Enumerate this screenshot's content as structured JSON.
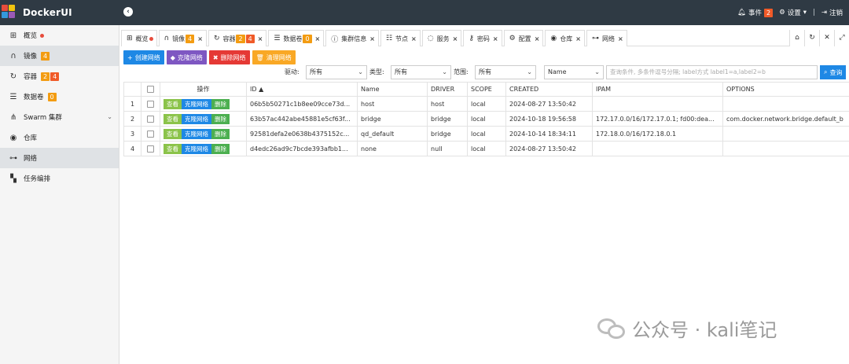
{
  "app": {
    "title": "DockerUI"
  },
  "topbar": {
    "events_label": "事件",
    "events_count": "2",
    "settings_label": "设置",
    "separator": "|",
    "logout_label": "注销"
  },
  "sidebar": {
    "items": [
      {
        "label": "概览",
        "icon": "windows-icon"
      },
      {
        "label": "镜像",
        "badge1": "4",
        "icon": "headphones-icon"
      },
      {
        "label": "容器",
        "badge1": "2",
        "badge2": "4",
        "icon": "refresh-icon"
      },
      {
        "label": "数据卷",
        "badge1": "0",
        "icon": "database-icon"
      },
      {
        "label": "Swarm 集群",
        "icon": "sitemap-icon"
      },
      {
        "label": "仓库",
        "icon": "podcast-icon"
      },
      {
        "label": "网络",
        "icon": "usb-icon"
      },
      {
        "label": "任务编排",
        "icon": "cubes-icon"
      }
    ]
  },
  "tabs": [
    {
      "label": "概览"
    },
    {
      "label": "镜像",
      "badge": "4"
    },
    {
      "label": "容器",
      "badge1": "2",
      "badge2": "4"
    },
    {
      "label": "数据卷",
      "badge": "0"
    },
    {
      "label": "集群信息"
    },
    {
      "label": "节点"
    },
    {
      "label": "服务"
    },
    {
      "label": "密码"
    },
    {
      "label": "配置"
    },
    {
      "label": "仓库"
    },
    {
      "label": "网络"
    }
  ],
  "toolbar": {
    "create": "创建网络",
    "clone": "克隆网络",
    "delete": "删除网络",
    "prune": "清理网络"
  },
  "filters": {
    "driver_label": "驱动:",
    "driver_value": "所有",
    "type_label": "类型:",
    "type_value": "所有",
    "scope_label": "范围:",
    "scope_value": "所有",
    "field_value": "Name",
    "search_placeholder": "查询条件, 多条件逗号分隔; label方式 label1=a,label2=b",
    "search_button": "查询"
  },
  "table": {
    "headers": {
      "ops": "操作",
      "id": "ID ▲",
      "name": "Name",
      "driver": "DRIVER",
      "scope": "SCOPE",
      "created": "CREATED",
      "ipam": "IPAM",
      "options": "OPTIONS"
    },
    "row_actions": {
      "view": "查看",
      "clone": "克隆网络",
      "delete": "删除"
    },
    "rows": [
      {
        "num": "1",
        "id": "06b5b50271c1b8ee09cce73d...",
        "name": "host",
        "driver": "host",
        "scope": "local",
        "created": "2024-08-27 13:50:42",
        "ipam": "",
        "options": ""
      },
      {
        "num": "2",
        "id": "63b57ac442abe45881e5cf63f...",
        "name": "bridge",
        "driver": "bridge",
        "scope": "local",
        "created": "2024-10-18 19:56:58",
        "ipam": "172.17.0.0/16/172.17.0.1; fd00:dea...",
        "options": "com.docker.network.bridge.default_b"
      },
      {
        "num": "3",
        "id": "92581defa2e0638b4375152c...",
        "name": "qd_default",
        "driver": "bridge",
        "scope": "local",
        "created": "2024-10-14 18:34:11",
        "ipam": "172.18.0.0/16/172.18.0.1",
        "options": ""
      },
      {
        "num": "4",
        "id": "d4edc26ad9c7bcde393afbb1...",
        "name": "none",
        "driver": "null",
        "scope": "local",
        "created": "2024-08-27 13:50:42",
        "ipam": "",
        "options": ""
      }
    ]
  },
  "watermark": {
    "text": "公众号 · kali笔记"
  }
}
